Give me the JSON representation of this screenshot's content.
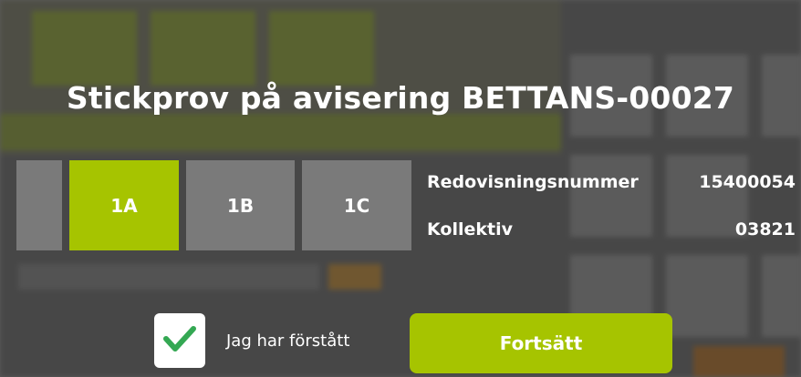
{
  "dialog": {
    "title": "Stickprov på avisering BETTANS-00027",
    "tiles": [
      {
        "label": "1A",
        "selected": true
      },
      {
        "label": "1B",
        "selected": false
      },
      {
        "label": "1C",
        "selected": false
      }
    ],
    "info": {
      "redovisningsnummer_label": "Redovisningsnummer",
      "redovisningsnummer_value": "15400054",
      "kollektiv_label": "Kollektiv",
      "kollektiv_value": "03821"
    },
    "confirm_checkbox": {
      "label": "Jag har förstått",
      "checked": true
    },
    "continue_label": "Fortsätt"
  },
  "colors": {
    "accent": "#a6c400",
    "tile_gray": "#7a7a7a",
    "overlay": "#3a3a3a"
  }
}
